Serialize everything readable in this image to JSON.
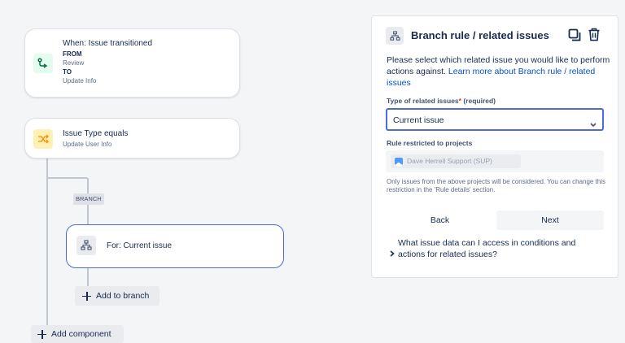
{
  "flow": {
    "trigger": {
      "title": "When: Issue transitioned",
      "from_label": "FROM",
      "from_value": "Review",
      "to_label": "TO",
      "to_value": "Update Info",
      "accent": "#e3fcef"
    },
    "condition": {
      "title": "Issue Type equals",
      "subtitle": "Update User Info",
      "accent": "#fff0b3"
    },
    "branch_badge": "BRANCH",
    "branch_node": {
      "title": "For: Current issue",
      "border": "#4c6bd8"
    },
    "add_to_branch": "Add to branch",
    "add_component": "Add component"
  },
  "panel": {
    "title": "Branch rule / related issues",
    "description": "Please select which related issue you would like to perform actions against.",
    "learn_more_link": "Learn more about Branch rule / related issues",
    "type_label": "Type of related issues",
    "required_star": "*",
    "required_text": "(required)",
    "type_value": "Current issue",
    "restricted_label": "Rule restricted to projects",
    "project_chip": "Dave Herrell Support (SUP)",
    "note": "Only issues from the above projects will be considered. You can change this restriction in the 'Rule details' section.",
    "back_label": "Back",
    "next_label": "Next",
    "faq": "What issue data can I access in conditions and actions for related issues?",
    "accent": "#0052cc"
  }
}
